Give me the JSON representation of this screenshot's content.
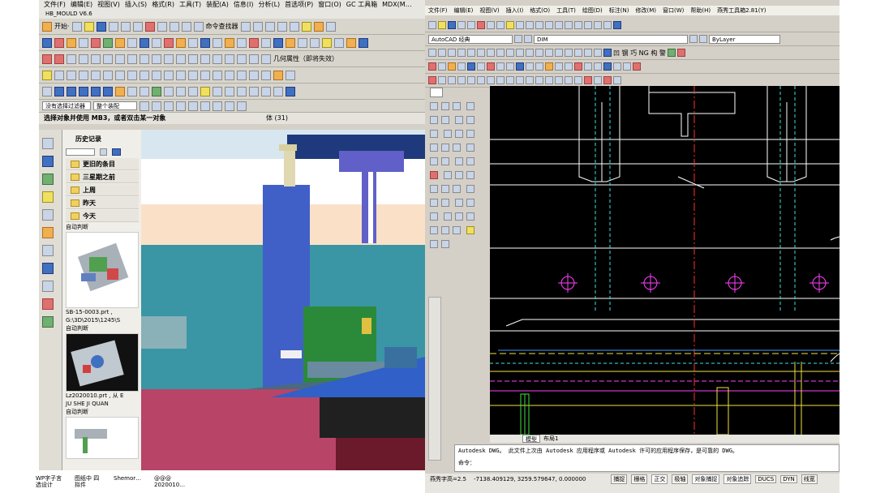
{
  "nx": {
    "menu": [
      "文件(F)",
      "编辑(E)",
      "视图(V)",
      "插入(S)",
      "格式(R)",
      "工具(T)",
      "装配(A)",
      "信息(I)",
      "分析(L)",
      "首选项(P)",
      "窗口(O)",
      "GC 工具箱",
      "MDX(M…"
    ],
    "app_title": "HB_MOULD V6.6",
    "start_label": "开始·",
    "command_finder": "命令查找器",
    "geometry_label": "几何属性（即将失效）",
    "filter_select": "没有选择过滤器",
    "assembly_select": "整个装配",
    "prompt": "选择对象并使用 MB3，或者双击某一对象",
    "status_right": "体 (31)",
    "history_title": "历史记录",
    "history_groups": [
      "更旧的条目",
      "三星期之前",
      "上周",
      "昨天",
      "今天"
    ],
    "thumbs": [
      {
        "label": "自动判断",
        "line1": "SB-15-0003.prt ,",
        "line2": "G:\\3D\\2015\\1245\\S"
      },
      {
        "label": "自动判断",
        "line1": "Lz2020010.prt , 从 E",
        "line2": "JU SHE JI QUAN"
      },
      {
        "label": "自动判断",
        "line1": "",
        "line2": ""
      }
    ]
  },
  "cad": {
    "menu": [
      "文件(F)",
      "编辑(E)",
      "视图(V)",
      "插入(I)",
      "格式(O)",
      "工具(T)",
      "绘图(D)",
      "标注(N)",
      "修改(M)",
      "窗口(W)",
      "帮助(H)",
      "燕秀工具箱2.81(Y)"
    ],
    "workspace": "AutoCAD 经典",
    "layer": "DIM",
    "linetype": "ByLayer",
    "glyph_bar": "凹 钢 巧 NG 构 警",
    "tabs": [
      "模型",
      "布局1"
    ],
    "command_lines": [
      "Autodesk DWG。  此文件上次由 Autodesk 应用程序或 Autodesk 许可的应用程序保存，是可靠的 DWG。",
      "命令："
    ],
    "text_height": "燕秀字高=2.5",
    "coords": "-7138.409129, 3259.579647, 0.000000",
    "status_buttons": [
      "捕捉",
      "栅格",
      "正交",
      "极轴",
      "对象捕捉",
      "对象追踪",
      "DUCS",
      "DYN",
      "线宽"
    ]
  },
  "taskbar": [
    {
      "line1": "WP字子言",
      "line2": "选设计"
    },
    {
      "line1": "图纸中 四",
      "line2": "拟件"
    },
    {
      "line1": "Shemor…",
      "line2": ""
    },
    {
      "line1": "@@@",
      "line2": "2020010…"
    }
  ]
}
